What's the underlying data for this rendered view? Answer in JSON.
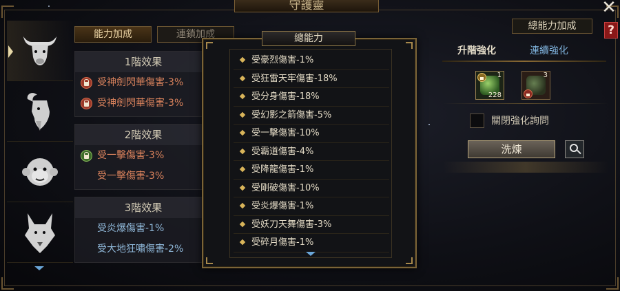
{
  "window": {
    "title": "守護靈"
  },
  "header": {
    "close_icon": "close-icon",
    "help_label": "?"
  },
  "animals": [
    {
      "name": "ox",
      "icon": "ox-icon",
      "active": true
    },
    {
      "name": "goat",
      "icon": "goat-icon",
      "active": false
    },
    {
      "name": "monkey",
      "icon": "monkey-icon",
      "active": false
    },
    {
      "name": "dog",
      "icon": "dog-icon",
      "active": false
    }
  ],
  "tabs": {
    "ability": "能力加成",
    "chain": "連鎖加成"
  },
  "effects": {
    "tier1": {
      "title": "1階效果",
      "rows": [
        "受神劍閃華傷害-3%",
        "受神劍閃華傷害-3%"
      ]
    },
    "tier2": {
      "title": "2階效果",
      "rows": [
        "受一擊傷害-3%",
        "受一擊傷害-3%"
      ]
    },
    "tier3": {
      "title": "3階效果",
      "rows": [
        "受炎爆傷害-1%",
        "受大地狂嘯傷害-2%"
      ]
    }
  },
  "popup": {
    "title": "總能力",
    "items": [
      "受豪烈傷害-1%",
      "受狂雷天牢傷害-18%",
      "受分身傷害-18%",
      "受幻影之箭傷害-5%",
      "受一擊傷害-10%",
      "受霸道傷害-4%",
      "受降龍傷害-1%",
      "受剛破傷害-10%",
      "受炎爆傷害-1%",
      "受妖刀天舞傷害-3%",
      "受碎月傷害-1%"
    ]
  },
  "right": {
    "total_button": "總能力加成",
    "tab_level": "升階強化",
    "tab_continuous": "連續強化",
    "slot_a": {
      "top": "1",
      "bottom": "228"
    },
    "slot_b": {
      "top": "3"
    },
    "checkbox_label": "關閉強化詢問",
    "refine_button": "洗煉"
  },
  "colors": {
    "frame_gold": "#7b6437",
    "effect_red": "#d9825c",
    "effect_blue": "#8fb7d8",
    "accent_blue": "#7fb2dc"
  }
}
